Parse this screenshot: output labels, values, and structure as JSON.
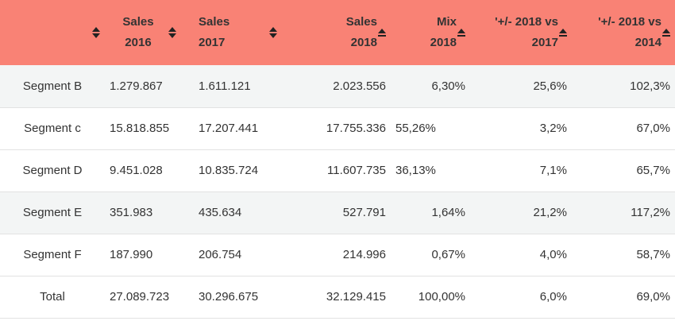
{
  "header": {
    "columns": [
      {
        "l1": "",
        "l2": ""
      },
      {
        "l1": "Sales",
        "l2": "2016"
      },
      {
        "l1": "Sales",
        "l2": "2017"
      },
      {
        "l1": "Sales",
        "l2": "2018"
      },
      {
        "l1": "Mix",
        "l2": "2018"
      },
      {
        "l1": "'+/- 2018 vs",
        "l2": "2017"
      },
      {
        "l1": "'+/- 2018 vs",
        "l2": "2014"
      }
    ]
  },
  "rows": [
    {
      "seg": "Segment B",
      "s2016": "1.279.867",
      "s2017": "1.611.121",
      "s2018": "2.023.556",
      "mix": "6,30%",
      "d2017": "25,6%",
      "d2014": "102,3%"
    },
    {
      "seg": "Segment c",
      "s2016": "15.818.855",
      "s2017": "17.207.441",
      "s2018": "17.755.336",
      "mix": "55,26%",
      "d2017": "3,2%",
      "d2014": "67,0%"
    },
    {
      "seg": "Segment D",
      "s2016": "9.451.028",
      "s2017": "10.835.724",
      "s2018": "11.607.735",
      "mix": "36,13%",
      "d2017": "7,1%",
      "d2014": "65,7%"
    },
    {
      "seg": "Segment E",
      "s2016": "351.983",
      "s2017": "435.634",
      "s2018": "527.791",
      "mix": "1,64%",
      "d2017": "21,2%",
      "d2014": "117,2%"
    },
    {
      "seg": "Segment F",
      "s2016": "187.990",
      "s2017": "206.754",
      "s2018": "214.996",
      "mix": "0,67%",
      "d2017": "4,0%",
      "d2014": "58,7%"
    },
    {
      "seg": "Total",
      "s2016": "27.089.723",
      "s2017": "30.296.675",
      "s2018": "32.129.415",
      "mix": "100,00%",
      "d2017": "6,0%",
      "d2014": "69,0%"
    }
  ],
  "colors": {
    "header_bg": "#f98275",
    "row_shade": "#f3f5f5",
    "border": "#e2e2e2"
  },
  "icons": {
    "sort": "sort-icon",
    "sort_desc": "sort-desc-icon"
  }
}
